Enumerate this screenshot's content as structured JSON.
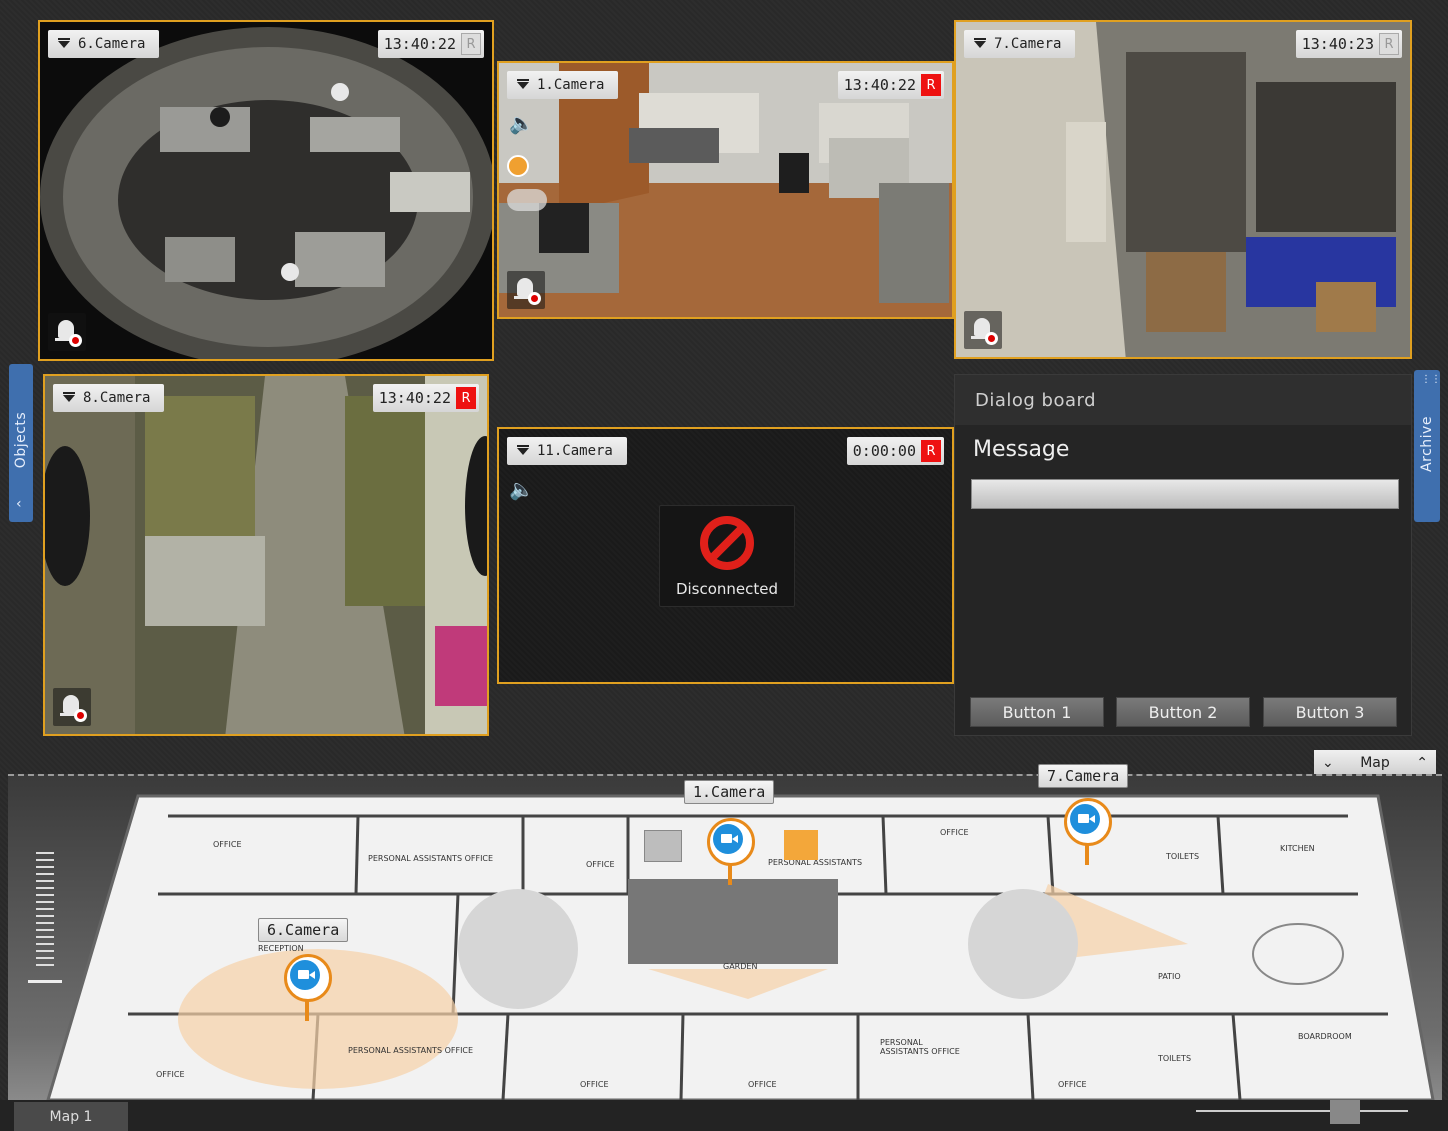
{
  "side_tabs": {
    "objects": "Objects",
    "archive": "Archive"
  },
  "colors": {
    "accent": "#e0a020",
    "rec_on": "#ee1111",
    "pin_blue": "#1f8fdc",
    "pin_orange": "#e88a1a",
    "tab_blue": "#3f6fae"
  },
  "cameras": [
    {
      "label": "6.Camera",
      "time": "13:40:22",
      "rec": "R",
      "recording": false
    },
    {
      "label": "1.Camera",
      "time": "13:40:22",
      "rec": "R",
      "recording": true
    },
    {
      "label": "7.Camera",
      "time": "13:40:23",
      "rec": "R",
      "recording": false
    },
    {
      "label": "8.Camera",
      "time": "13:40:22",
      "rec": "R",
      "recording": true
    },
    {
      "label": "11.Camera",
      "time": "0:00:00",
      "rec": "R",
      "recording": true,
      "status": "Disconnected"
    }
  ],
  "dialog": {
    "title": "Dialog board",
    "message": "Message",
    "buttons": [
      "Button 1",
      "Button 2",
      "Button 3"
    ]
  },
  "map": {
    "control_label": "Map",
    "tab_label": "Map 1",
    "camera_labels": [
      "1.Camera",
      "7.Camera",
      "6.Camera"
    ],
    "rooms": [
      "OFFICE",
      "PERSONAL ASSISTANTS OFFICE",
      "OFFICE",
      "PERSONAL ASSISTANTS",
      "OFFICE",
      "TOILETS",
      "KITCHEN",
      "RECEPTION",
      "GARDEN",
      "PATIO",
      "OFFICE",
      "PERSONAL ASSISTANTS OFFICE",
      "OFFICE",
      "OFFICE",
      "PERSONAL ASSISTANTS OFFICE",
      "OFFICE",
      "TOILETS",
      "BOARDROOM"
    ]
  }
}
